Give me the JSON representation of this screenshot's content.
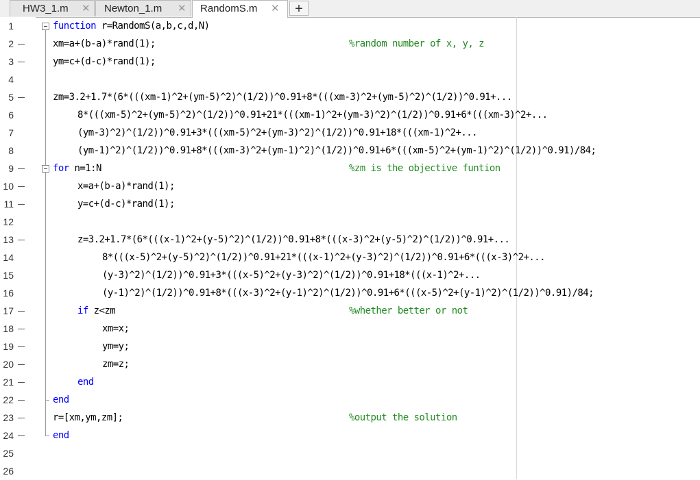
{
  "tabs": [
    {
      "label": "HW3_1.m",
      "close": "✕",
      "active": false
    },
    {
      "label": "Newton_1.m",
      "close": "✕",
      "active": false
    },
    {
      "label": "RandomS.m",
      "close": "✕",
      "active": true
    }
  ],
  "add_tab_label": "+",
  "colors": {
    "keyword": "#0000ff",
    "comment": "#228b22",
    "text": "#000000"
  },
  "lines": [
    {
      "n": "1",
      "bp": false,
      "indent": 0,
      "segs": [
        {
          "t": "function",
          "c": "kw"
        },
        {
          "t": " r=RandomS(a,b,c,d,N)",
          "c": ""
        }
      ]
    },
    {
      "n": "2",
      "bp": true,
      "indent": 0,
      "segs": [
        {
          "t": "xm=a+(b-a)*rand(1);",
          "c": ""
        }
      ],
      "comment": "%random number of x, y, z"
    },
    {
      "n": "3",
      "bp": true,
      "indent": 0,
      "segs": [
        {
          "t": "ym=c+(d-c)*rand(1);",
          "c": ""
        }
      ]
    },
    {
      "n": "4",
      "bp": false,
      "indent": 0,
      "segs": []
    },
    {
      "n": "5",
      "bp": true,
      "indent": 0,
      "segs": [
        {
          "t": "zm=3.2+1.7*(6*(((xm-1)^2+(ym-5)^2)^(1/2))^0.91+8*(((xm-3)^2+(ym-5)^2)^(1/2))^0.91+...",
          "c": ""
        }
      ]
    },
    {
      "n": "6",
      "bp": false,
      "indent": 1,
      "segs": [
        {
          "t": "8*(((xm-5)^2+(ym-5)^2)^(1/2))^0.91+21*(((xm-1)^2+(ym-3)^2)^(1/2))^0.91+6*(((xm-3)^2+...",
          "c": ""
        }
      ]
    },
    {
      "n": "7",
      "bp": false,
      "indent": 1,
      "segs": [
        {
          "t": "(ym-3)^2)^(1/2))^0.91+3*(((xm-5)^2+(ym-3)^2)^(1/2))^0.91+18*(((xm-1)^2+...",
          "c": ""
        }
      ]
    },
    {
      "n": "8",
      "bp": false,
      "indent": 1,
      "segs": [
        {
          "t": "(ym-1)^2)^(1/2))^0.91+8*(((xm-3)^2+(ym-1)^2)^(1/2))^0.91+6*(((xm-5)^2+(ym-1)^2)^(1/2))^0.91)/84;",
          "c": ""
        }
      ]
    },
    {
      "n": "9",
      "bp": true,
      "indent": 0,
      "segs": [
        {
          "t": "for",
          "c": "kw"
        },
        {
          "t": " n=1:N",
          "c": ""
        }
      ],
      "comment": "%zm is the objective funtion"
    },
    {
      "n": "10",
      "bp": true,
      "indent": 1,
      "segs": [
        {
          "t": "x=a+(b-a)*rand(1);",
          "c": ""
        }
      ]
    },
    {
      "n": "11",
      "bp": true,
      "indent": 1,
      "segs": [
        {
          "t": "y=c+(d-c)*rand(1);",
          "c": ""
        }
      ]
    },
    {
      "n": "12",
      "bp": false,
      "indent": 0,
      "segs": []
    },
    {
      "n": "13",
      "bp": true,
      "indent": 1,
      "segs": [
        {
          "t": "z=3.2+1.7*(6*(((x-1)^2+(y-5)^2)^(1/2))^0.91+8*(((x-3)^2+(y-5)^2)^(1/2))^0.91+...",
          "c": ""
        }
      ]
    },
    {
      "n": "14",
      "bp": false,
      "indent": 2,
      "segs": [
        {
          "t": "8*(((x-5)^2+(y-5)^2)^(1/2))^0.91+21*(((x-1)^2+(y-3)^2)^(1/2))^0.91+6*(((x-3)^2+...",
          "c": ""
        }
      ]
    },
    {
      "n": "15",
      "bp": false,
      "indent": 2,
      "segs": [
        {
          "t": "(y-3)^2)^(1/2))^0.91+3*(((x-5)^2+(y-3)^2)^(1/2))^0.91+18*(((x-1)^2+...",
          "c": ""
        }
      ]
    },
    {
      "n": "16",
      "bp": false,
      "indent": 2,
      "segs": [
        {
          "t": "(y-1)^2)^(1/2))^0.91+8*(((x-3)^2+(y-1)^2)^(1/2))^0.91+6*(((x-5)^2+(y-1)^2)^(1/2))^0.91)/84;",
          "c": ""
        }
      ]
    },
    {
      "n": "17",
      "bp": true,
      "indent": 1,
      "segs": [
        {
          "t": "if",
          "c": "kw"
        },
        {
          "t": " z<zm",
          "c": ""
        }
      ],
      "comment": "%whether better or not"
    },
    {
      "n": "18",
      "bp": true,
      "indent": 2,
      "segs": [
        {
          "t": "xm=x;",
          "c": ""
        }
      ]
    },
    {
      "n": "19",
      "bp": true,
      "indent": 2,
      "segs": [
        {
          "t": "ym=y;",
          "c": ""
        }
      ]
    },
    {
      "n": "20",
      "bp": true,
      "indent": 2,
      "segs": [
        {
          "t": "zm=z;",
          "c": ""
        }
      ]
    },
    {
      "n": "21",
      "bp": true,
      "indent": 1,
      "segs": [
        {
          "t": "end",
          "c": "kw"
        }
      ]
    },
    {
      "n": "22",
      "bp": true,
      "indent": 0,
      "segs": [
        {
          "t": "end",
          "c": "kw"
        }
      ]
    },
    {
      "n": "23",
      "bp": true,
      "indent": 0,
      "segs": [
        {
          "t": "r=[xm,ym,zm];",
          "c": ""
        }
      ],
      "comment": "%output the solution"
    },
    {
      "n": "24",
      "bp": true,
      "indent": 0,
      "segs": [
        {
          "t": "end",
          "c": "kw"
        }
      ]
    },
    {
      "n": "25",
      "bp": false,
      "indent": 0,
      "segs": []
    },
    {
      "n": "26",
      "bp": false,
      "indent": 0,
      "segs": []
    }
  ]
}
